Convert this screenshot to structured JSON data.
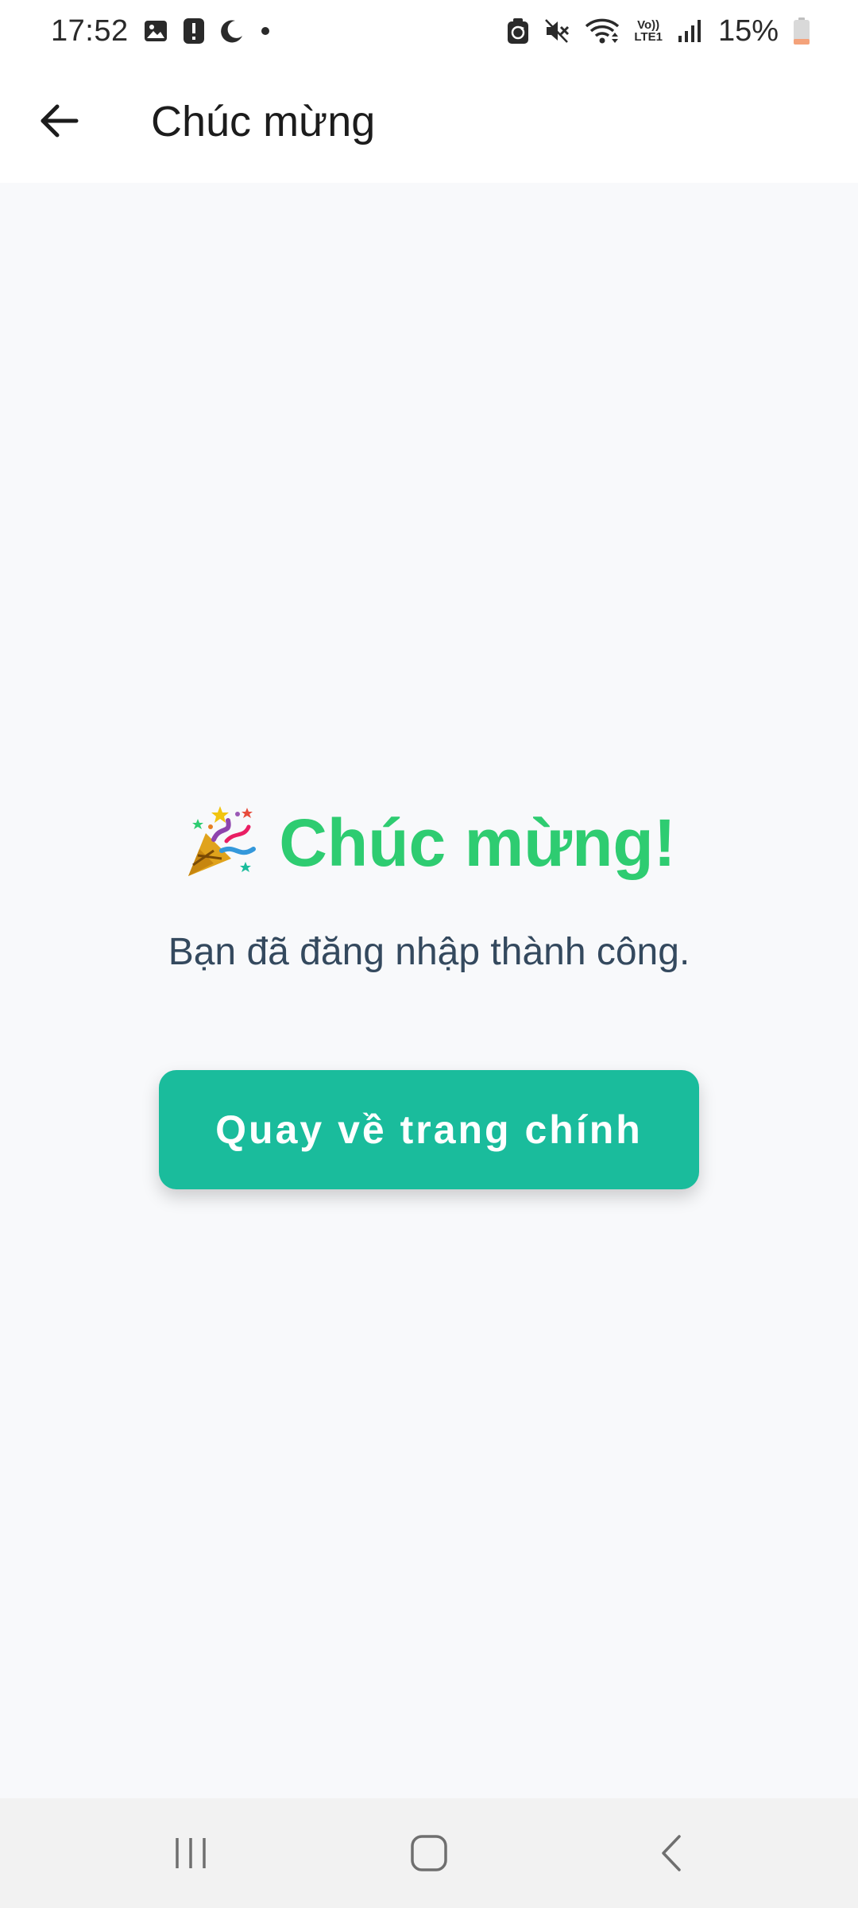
{
  "status_bar": {
    "time": "17:52",
    "battery_percent": "15%",
    "left_icons": [
      "gallery-icon",
      "alert-icon",
      "moon-icon",
      "dot-icon"
    ],
    "right_icons": [
      "sync-icon",
      "mute-icon",
      "wifi-icon",
      "volte-icon",
      "signal-icon",
      "battery-icon"
    ],
    "volte_label_top": "Vo))",
    "volte_label_bottom": "LTE1"
  },
  "app_bar": {
    "title": "Chúc mừng",
    "back_icon": "arrow-left-icon"
  },
  "main": {
    "headline": "Chúc mừng!",
    "headline_icon": "party-popper-icon",
    "subtitle": "Bạn đã đăng nhập thành công.",
    "button_label": "Quay về trang chính"
  },
  "nav_bar": {
    "icons": [
      "recents-icon",
      "home-icon",
      "back-icon"
    ]
  },
  "colors": {
    "accent_green": "#2ecc71",
    "button_teal": "#1abc9c",
    "subtitle_text": "#34495e",
    "background": "#f8f9fb"
  }
}
